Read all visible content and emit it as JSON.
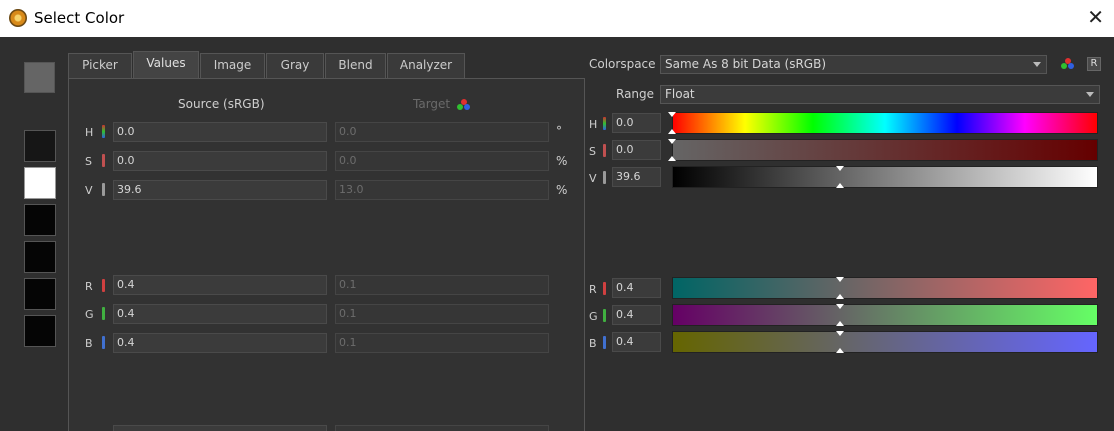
{
  "window": {
    "title": "Select Color",
    "close_glyph": "✕"
  },
  "swatches": [
    {
      "name": "current",
      "color": "#656565"
    },
    {
      "name": "history-1",
      "color": "#161616"
    },
    {
      "name": "history-2",
      "color": "#ffffff"
    },
    {
      "name": "history-3",
      "color": "#050505"
    },
    {
      "name": "history-4",
      "color": "#050505"
    },
    {
      "name": "history-5",
      "color": "#050505"
    },
    {
      "name": "history-6",
      "color": "#050505"
    }
  ],
  "tabs": [
    {
      "label": "Picker",
      "active": false
    },
    {
      "label": "Values",
      "active": true
    },
    {
      "label": "Image",
      "active": false
    },
    {
      "label": "Gray",
      "active": false
    },
    {
      "label": "Blend",
      "active": false
    },
    {
      "label": "Analyzer",
      "active": false
    }
  ],
  "values_panel": {
    "source_header": "Source (sRGB)",
    "target_header": "Target",
    "rows": [
      {
        "channel": "H",
        "source": "0.0",
        "target": "0.0",
        "unit": "°"
      },
      {
        "channel": "S",
        "source": "0.0",
        "target": "0.0",
        "unit": "%"
      },
      {
        "channel": "V",
        "source": "39.6",
        "target": "13.0",
        "unit": "%"
      },
      {
        "channel": "R",
        "source": "0.4",
        "target": "0.1",
        "unit": ""
      },
      {
        "channel": "G",
        "source": "0.4",
        "target": "0.1",
        "unit": ""
      },
      {
        "channel": "B",
        "source": "0.4",
        "target": "0.1",
        "unit": ""
      }
    ]
  },
  "right_panel": {
    "colorspace_label": "Colorspace",
    "colorspace_value": "Same As 8 bit Data (sRGB)",
    "range_label": "Range",
    "range_value": "Float",
    "r_button": "R",
    "sliders": [
      {
        "channel": "H",
        "value": "0.0",
        "position": 0.0
      },
      {
        "channel": "S",
        "value": "0.0",
        "position": 0.0
      },
      {
        "channel": "V",
        "value": "39.6",
        "position": 0.396
      },
      {
        "channel": "R",
        "value": "0.4",
        "position": 0.4
      },
      {
        "channel": "G",
        "value": "0.4",
        "position": 0.4
      },
      {
        "channel": "B",
        "value": "0.4",
        "position": 0.4
      }
    ]
  },
  "colors": {
    "hue_indicator": "#d9b030",
    "sat_indicator": "#c05050",
    "val_indicator": "#9a9a9a",
    "red": "#d04040",
    "green": "#40b040",
    "blue": "#4070d0"
  }
}
